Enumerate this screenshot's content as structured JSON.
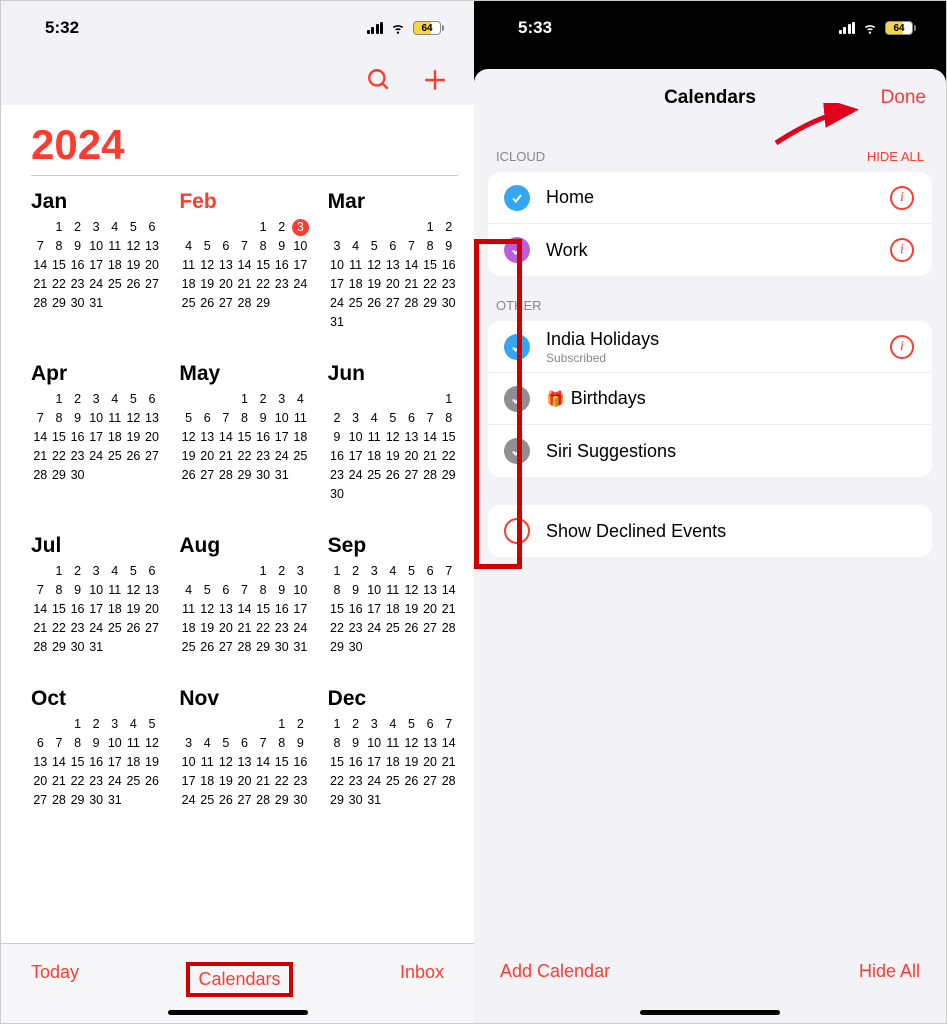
{
  "left": {
    "time": "5:32",
    "battery": "64",
    "year": "2024",
    "tabbar": {
      "today": "Today",
      "calendars": "Calendars",
      "inbox": "Inbox"
    },
    "months": [
      {
        "name": "Jan",
        "current": false,
        "offset": 1,
        "days": 31,
        "today": null
      },
      {
        "name": "Feb",
        "current": true,
        "offset": 4,
        "days": 29,
        "today": 3
      },
      {
        "name": "Mar",
        "current": false,
        "offset": 5,
        "days": 31,
        "today": null
      },
      {
        "name": "Apr",
        "current": false,
        "offset": 1,
        "days": 30,
        "today": null
      },
      {
        "name": "May",
        "current": false,
        "offset": 3,
        "days": 31,
        "today": null
      },
      {
        "name": "Jun",
        "current": false,
        "offset": 6,
        "days": 30,
        "today": null
      },
      {
        "name": "Jul",
        "current": false,
        "offset": 1,
        "days": 31,
        "today": null
      },
      {
        "name": "Aug",
        "current": false,
        "offset": 4,
        "days": 31,
        "today": null
      },
      {
        "name": "Sep",
        "current": false,
        "offset": 0,
        "days": 30,
        "today": null
      },
      {
        "name": "Oct",
        "current": false,
        "offset": 2,
        "days": 31,
        "today": null
      },
      {
        "name": "Nov",
        "current": false,
        "offset": 5,
        "days": 30,
        "today": null
      },
      {
        "name": "Dec",
        "current": false,
        "offset": 0,
        "days": 31,
        "today": null
      }
    ]
  },
  "right": {
    "time": "5:33",
    "battery": "64",
    "title": "Calendars",
    "done": "Done",
    "sections": {
      "icloud": {
        "header": "ICLOUD",
        "action": "HIDE ALL",
        "items": [
          {
            "label": "Home",
            "sub": null,
            "color": "blue",
            "info": true
          },
          {
            "label": "Work",
            "sub": null,
            "color": "purple",
            "info": true
          }
        ]
      },
      "other": {
        "header": "OTHER",
        "items": [
          {
            "label": "India Holidays",
            "sub": "Subscribed",
            "color": "blue",
            "info": true,
            "gift": false
          },
          {
            "label": "Birthdays",
            "sub": null,
            "color": "grey",
            "info": false,
            "gift": true
          },
          {
            "label": "Siri Suggestions",
            "sub": null,
            "color": "grey",
            "info": false,
            "gift": false
          }
        ]
      }
    },
    "declined": "Show Declined Events",
    "bottom": {
      "add": "Add Calendar",
      "hide": "Hide All"
    }
  }
}
